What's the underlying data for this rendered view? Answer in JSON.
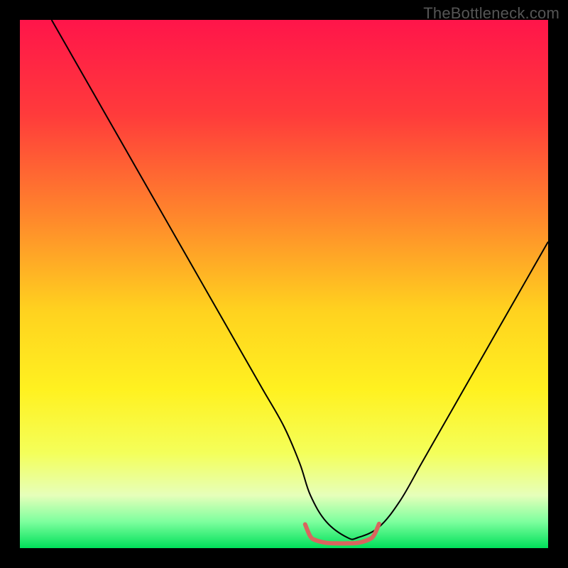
{
  "watermark": "TheBottleneck.com",
  "chart_data": {
    "type": "line",
    "title": "",
    "xlabel": "",
    "ylabel": "",
    "xlim": [
      0,
      100
    ],
    "ylim": [
      0,
      100
    ],
    "grid": false,
    "legend": false,
    "background_gradient": {
      "direction": "vertical",
      "stops": [
        {
          "offset": 0.0,
          "color": "#ff154a"
        },
        {
          "offset": 0.18,
          "color": "#ff3b3b"
        },
        {
          "offset": 0.38,
          "color": "#ff8a2b"
        },
        {
          "offset": 0.55,
          "color": "#ffd21f"
        },
        {
          "offset": 0.7,
          "color": "#fff120"
        },
        {
          "offset": 0.82,
          "color": "#f4ff5a"
        },
        {
          "offset": 0.9,
          "color": "#e6ffba"
        },
        {
          "offset": 0.95,
          "color": "#7dff9e"
        },
        {
          "offset": 1.0,
          "color": "#00e05a"
        }
      ]
    },
    "series": [
      {
        "name": "curve",
        "color": "#000000",
        "width": 2,
        "x": [
          6,
          10,
          14,
          18,
          22,
          26,
          30,
          34,
          38,
          42,
          46,
          50,
          53,
          55,
          58,
          62,
          64,
          68,
          72,
          76,
          80,
          84,
          88,
          92,
          96,
          100
        ],
        "y": [
          100,
          93,
          86,
          79,
          72,
          65,
          58,
          51,
          44,
          37,
          30,
          23,
          16,
          10,
          5,
          2,
          2,
          4,
          9,
          16,
          23,
          30,
          37,
          44,
          51,
          58
        ]
      },
      {
        "name": "trough-highlight",
        "color": "#d9655e",
        "width": 6,
        "cap": "round",
        "x": [
          54,
          55,
          56,
          58,
          60,
          62,
          64,
          66,
          67,
          68
        ],
        "y": [
          4.5,
          2.2,
          1.5,
          1.0,
          0.9,
          0.9,
          1.0,
          1.6,
          2.4,
          4.6
        ]
      }
    ]
  }
}
